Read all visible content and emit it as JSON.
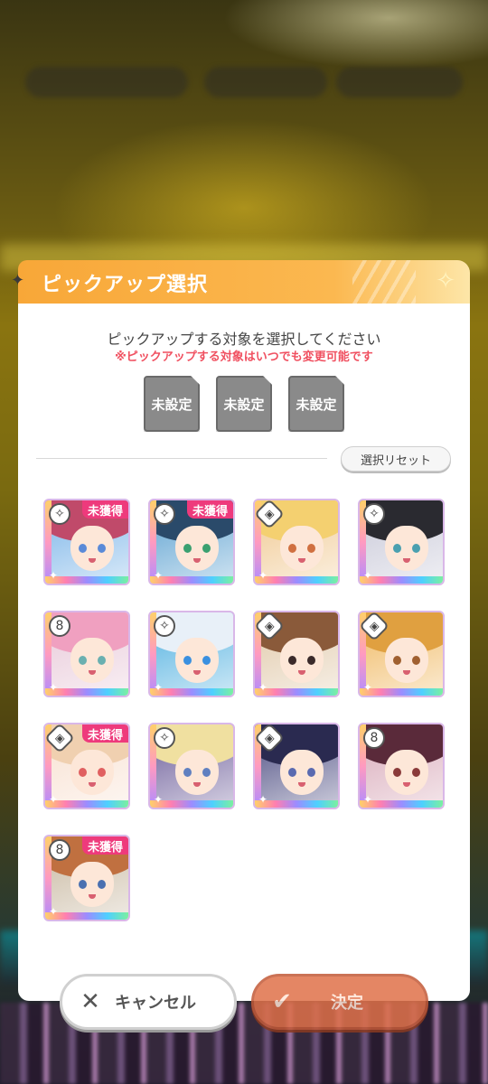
{
  "dialog": {
    "title": "ピックアップ選択",
    "instruction": "ピックアップする対象を選択してください",
    "note": "※ピックアップする対象はいつでも変更可能です",
    "slots": [
      "未設定",
      "未設定",
      "未設定"
    ],
    "reset_label": "選択リセット"
  },
  "cards": [
    {
      "attr": "sparkle-icon",
      "badge": "未獲得",
      "hair": "#c04a6a",
      "eye": "#5a8ad8",
      "bg": "#7ab4e8"
    },
    {
      "attr": "sparkle-icon",
      "badge": "未獲得",
      "hair": "#2a4a6a",
      "eye": "#3aa070",
      "bg": "#5aa0d0"
    },
    {
      "attr": "cool-icon",
      "badge": "",
      "hair": "#f4d070",
      "eye": "#d07040",
      "bg": "#f0c890"
    },
    {
      "attr": "sparkle-icon",
      "badge": "",
      "hair": "#2a2a30",
      "eye": "#4aa0b0",
      "bg": "#c8c8d8"
    },
    {
      "attr": "mysterious-icon",
      "badge": "",
      "hair": "#f0a0c0",
      "eye": "#6ab0b0",
      "bg": "#e8c8d8"
    },
    {
      "attr": "sparkle-icon",
      "badge": "",
      "hair": "#e8f0f8",
      "eye": "#3a90e0",
      "bg": "#50b0e0"
    },
    {
      "attr": "cool-icon",
      "badge": "",
      "hair": "#8a5a3a",
      "eye": "#3a2a2a",
      "bg": "#e0c8a8"
    },
    {
      "attr": "cool-icon",
      "badge": "",
      "hair": "#e0a040",
      "eye": "#a06030",
      "bg": "#f0b860"
    },
    {
      "attr": "cool-icon",
      "badge": "未獲得",
      "hair": "#f0d0b0",
      "eye": "#e06060",
      "bg": "#f8e0d0"
    },
    {
      "attr": "sparkle-icon",
      "badge": "",
      "hair": "#f0e0a0",
      "eye": "#6080c0",
      "bg": "#6a5a98"
    },
    {
      "attr": "cool-icon",
      "badge": "",
      "hair": "#2a2a50",
      "eye": "#5a6ab0",
      "bg": "#4a4a80"
    },
    {
      "attr": "mysterious-icon",
      "badge": "",
      "hair": "#5a2a3a",
      "eye": "#8a3a3a",
      "bg": "#d8a8b8"
    },
    {
      "attr": "mysterious-icon",
      "badge": "未獲得",
      "hair": "#c07040",
      "eye": "#4a70b0",
      "bg": "#c8b8a0"
    }
  ],
  "buttons": {
    "cancel_label": "キャンセル",
    "ok_label": "決定"
  }
}
